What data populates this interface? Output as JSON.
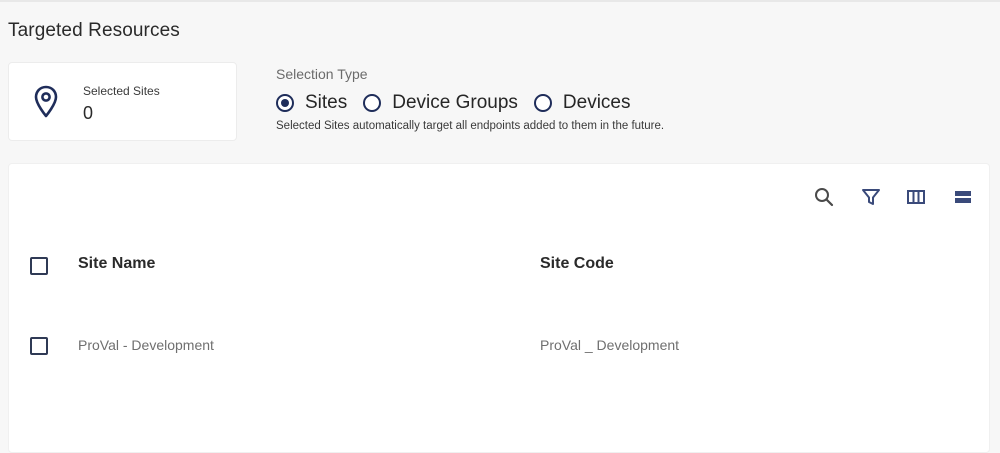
{
  "page": {
    "title": "Targeted Resources"
  },
  "selected_sites": {
    "label": "Selected Sites",
    "count": "0",
    "icon": "map-pin-icon"
  },
  "selection_type": {
    "label": "Selection Type",
    "options": [
      {
        "label": "Sites",
        "checked": true
      },
      {
        "label": "Device Groups",
        "checked": false
      },
      {
        "label": "Devices",
        "checked": false
      }
    ],
    "help_text": "Selected Sites automatically target all endpoints added to them in the future."
  },
  "toolbar": {
    "icons": [
      "search-icon",
      "filter-icon",
      "columns-icon",
      "density-icon"
    ]
  },
  "table": {
    "columns": [
      "Site Name",
      "Site Code"
    ],
    "rows": [
      {
        "site_name": "ProVal - Development",
        "site_code": "ProVal _ Development"
      }
    ]
  },
  "colors": {
    "accent": "#1f2d5a",
    "toolbar_icon": "#3a4a7a"
  }
}
